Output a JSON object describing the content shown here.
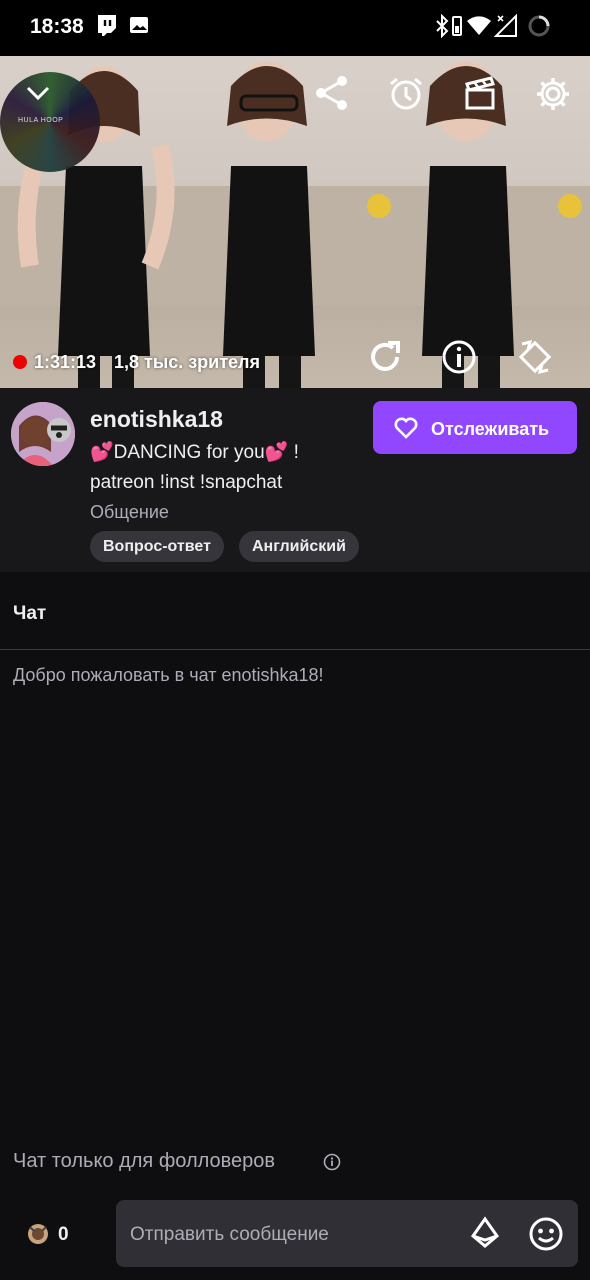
{
  "status_bar": {
    "time": "18:38",
    "icons": [
      "twitch-notification-icon",
      "image-notification-icon",
      "bluetooth-icon",
      "battery-saver-icon",
      "wifi-icon",
      "signal-icon",
      "loading-icon"
    ]
  },
  "player": {
    "overlay_text": "HULA HOOP",
    "stream_time": "1:31:13",
    "viewers": "1,8 тыс. зрителя",
    "live_color": "#eb0400",
    "top_icons": [
      "chevron-down-icon",
      "share-icon",
      "alarm-icon",
      "clip-icon",
      "settings-icon"
    ],
    "bottom_icons": [
      "refresh-icon",
      "info-icon",
      "rotate-icon"
    ]
  },
  "channel": {
    "name": "enotishka18",
    "title_line1": "💕DANCING for you💕 !",
    "title_line2": "patreon !inst !snapchat",
    "category": "Общение",
    "tags": [
      "Вопрос-ответ",
      "Английский"
    ],
    "follow_label": "Отслеживать",
    "accent": "#9147ff"
  },
  "chat": {
    "title": "Чат",
    "welcome": "Добро пожаловать в чат enotishka18!",
    "followers_only": "Чат только для фолловеров",
    "points": "0",
    "placeholder": "Отправить сообщение"
  }
}
